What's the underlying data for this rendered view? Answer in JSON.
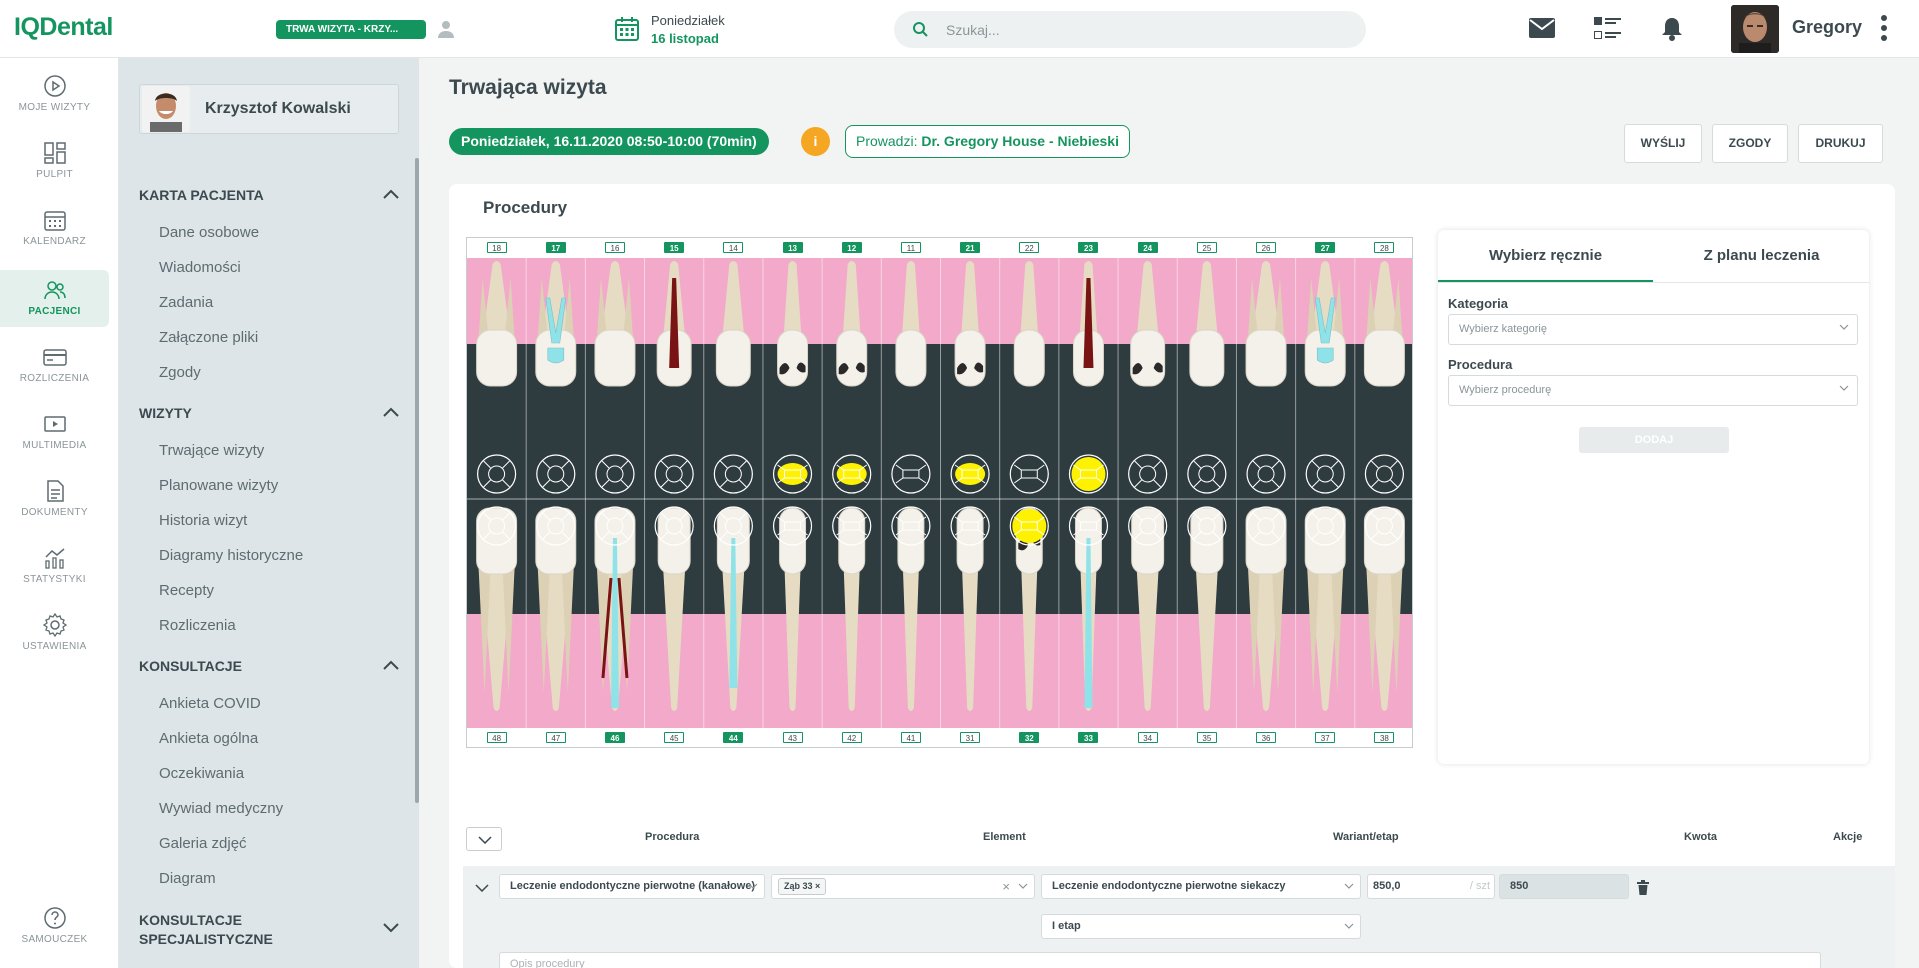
{
  "app": {
    "logo": "IQDental"
  },
  "topbar": {
    "visit_badge": "TRWA WIZYTA - KRZY...",
    "date_day": "Poniedziałek",
    "date_date": "16 listopad",
    "search_placeholder": "Szukaj...",
    "user_name": "Gregory"
  },
  "nav": [
    {
      "label": "MOJE WIZYTY",
      "icon": "play-circle-icon"
    },
    {
      "label": "PULPIT",
      "icon": "dashboard-icon"
    },
    {
      "label": "KALENDARZ",
      "icon": "calendar-icon"
    },
    {
      "label": "PACJENCI",
      "icon": "users-icon",
      "active": true
    },
    {
      "label": "ROZLICZENIA",
      "icon": "credit-card-icon"
    },
    {
      "label": "MULTIMEDIA",
      "icon": "media-icon"
    },
    {
      "label": "DOKUMENTY",
      "icon": "document-icon"
    },
    {
      "label": "STATYSTYKI",
      "icon": "stats-icon"
    },
    {
      "label": "USTAWIENIA",
      "icon": "gear-icon"
    },
    {
      "label": "SAMOUCZEK",
      "icon": "help-icon"
    }
  ],
  "patient": {
    "name": "Krzysztof Kowalski",
    "sections": [
      {
        "title": "KARTA PACJENTA",
        "items": [
          "Dane osobowe",
          "Wiadomości",
          "Zadania",
          "Załączone pliki",
          "Zgody"
        ]
      },
      {
        "title": "WIZYTY",
        "items": [
          "Trwające wizyty",
          "Planowane wizyty",
          "Historia wizyt",
          "Diagramy historyczne",
          "Recepty",
          "Rozliczenia"
        ]
      },
      {
        "title": "KONSULTACJE",
        "items": [
          "Ankieta COVID",
          "Ankieta ogólna",
          "Oczekiwania",
          "Wywiad medyczny",
          "Galeria zdjęć",
          "Diagram"
        ]
      },
      {
        "title": "KONSULTACJE SPECJALISTYCZNE",
        "items": []
      }
    ]
  },
  "main": {
    "title": "Trwająca wizyta",
    "visit_date": "Poniedziałek, 16.11.2020 08:50-10:00 (70min)",
    "info_badge": "i",
    "doctor_prefix": "Prowadzi: ",
    "doctor_name": "Dr. Gregory House - Niebieski",
    "actions": [
      "WYŚLIJ",
      "ZGODY",
      "DRUKUJ"
    ],
    "card_title": "Procedury"
  },
  "teeth": {
    "upper": [
      "18",
      "17",
      "16",
      "15",
      "14",
      "13",
      "12",
      "11",
      "21",
      "22",
      "23",
      "24",
      "25",
      "26",
      "27",
      "28"
    ],
    "upper_highlighted": [
      "17",
      "15",
      "13",
      "12",
      "21",
      "23",
      "24",
      "27"
    ],
    "lower": [
      "48",
      "47",
      "46",
      "45",
      "44",
      "43",
      "42",
      "41",
      "31",
      "32",
      "33",
      "34",
      "35",
      "36",
      "37",
      "38"
    ],
    "lower_highlighted": [
      "46",
      "44",
      "32",
      "33"
    ]
  },
  "side": {
    "tabs": [
      "Wybierz ręcznie",
      "Z planu leczenia"
    ],
    "category_label": "Kategoria",
    "category_placeholder": "Wybierz kategorię",
    "procedure_label": "Procedura",
    "procedure_placeholder": "Wybierz procedurę",
    "add_button": "DODAJ"
  },
  "table": {
    "headers": {
      "procedure": "Procedura",
      "element": "Element",
      "variant": "Wariant/etap",
      "amount": "Kwota",
      "actions": "Akcje"
    },
    "row": {
      "procedure": "Leczenie endodontyczne pierwotne (kanałowe)",
      "element_tag": "Ząb 33",
      "variant": "Leczenie endodontyczne pierwotne siekaczy",
      "qty": "850,0",
      "qty_unit": "/ szt",
      "amount": "850",
      "stage": "I etap",
      "description_placeholder": "Opis procedury"
    }
  },
  "colors": {
    "brand": "#14955f",
    "warning": "#f5a623",
    "gum": "#f3a9c9",
    "chart_bg": "#2e3b3f",
    "filling": "#fff200",
    "root_canal": "#8fe3e8"
  }
}
